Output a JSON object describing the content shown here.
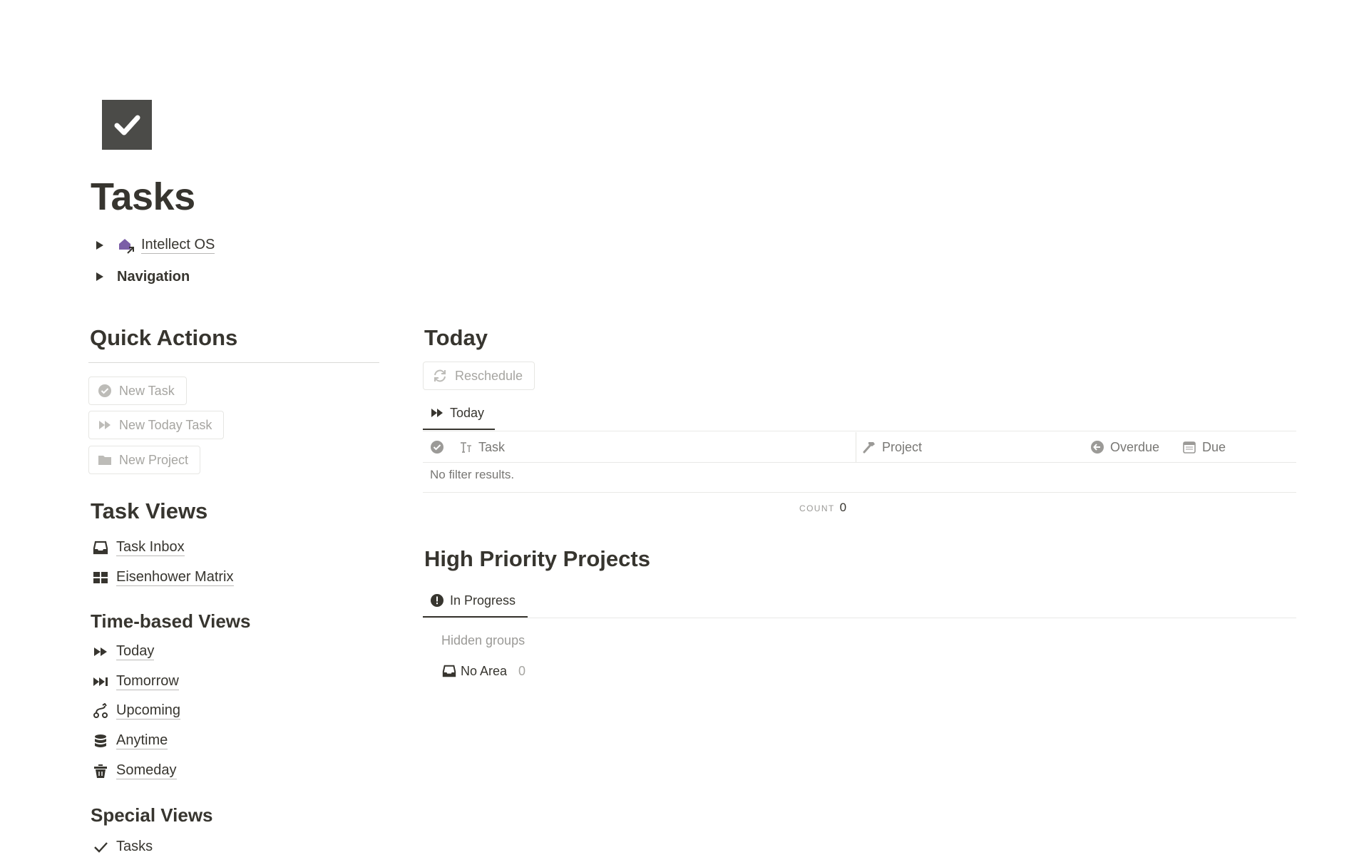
{
  "page": {
    "icon": "checkbox-icon",
    "title": "Tasks"
  },
  "toggles": [
    {
      "label": "Intellect OS",
      "icon": "home-link-icon",
      "icon_color": "#7b5ea7"
    },
    {
      "label": "Navigation"
    }
  ],
  "quick_actions": {
    "title": "Quick Actions",
    "buttons": [
      {
        "label": "New Task",
        "icon": "check-circle-icon"
      },
      {
        "label": "New Today Task",
        "icon": "fast-forward-icon"
      },
      {
        "label": "New Project",
        "icon": "folder-icon"
      }
    ]
  },
  "task_views": {
    "title": "Task Views",
    "items": [
      {
        "label": "Task Inbox",
        "icon": "inbox-icon"
      },
      {
        "label": "Eisenhower Matrix",
        "icon": "grid-icon"
      }
    ]
  },
  "time_views": {
    "title": "Time-based Views",
    "items": [
      {
        "label": "Today",
        "icon": "fast-forward-icon"
      },
      {
        "label": "Tomorrow",
        "icon": "skip-forward-icon"
      },
      {
        "label": "Upcoming",
        "icon": "route-icon"
      },
      {
        "label": "Anytime",
        "icon": "database-icon"
      },
      {
        "label": "Someday",
        "icon": "trash-icon"
      }
    ]
  },
  "special_views": {
    "title": "Special Views",
    "items": [
      {
        "label": "Tasks",
        "icon": "checkmark-icon"
      }
    ]
  },
  "today_section": {
    "title": "Today",
    "reschedule_label": "Reschedule",
    "tab_label": "Today",
    "columns": {
      "status_icon": "check-circle-icon",
      "task": "Task",
      "project": "Project",
      "overdue": "Overdue",
      "due": "Due"
    },
    "empty_text": "No filter results.",
    "count_label": "COUNT",
    "count_value": "0"
  },
  "projects_section": {
    "title": "High Priority Projects",
    "tab_label": "In Progress",
    "hidden_groups_label": "Hidden groups",
    "group": {
      "label": "No Area",
      "count": "0",
      "icon": "inbox-icon"
    }
  },
  "colors": {
    "text": "#37352f",
    "muted": "#787774",
    "faint": "#a6a5a1",
    "icon_bg": "#4b4b48"
  }
}
